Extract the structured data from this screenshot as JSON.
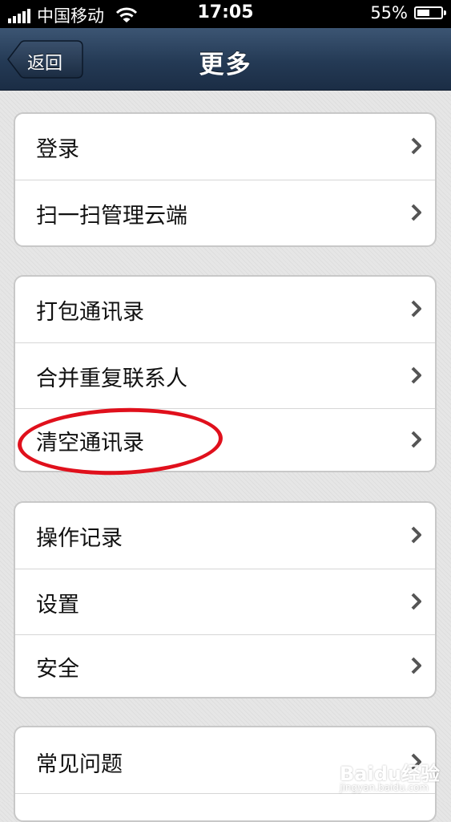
{
  "status_bar": {
    "carrier": "中国移动",
    "time": "17:05",
    "battery": "55%",
    "battery_level": 0.55
  },
  "nav": {
    "back_label": "返回",
    "title": "更多"
  },
  "groups": [
    {
      "items": [
        {
          "label": "登录"
        },
        {
          "label": "扫一扫管理云端"
        }
      ]
    },
    {
      "items": [
        {
          "label": "打包通讯录"
        },
        {
          "label": "合并重复联系人"
        },
        {
          "label": "清空通讯录"
        }
      ]
    },
    {
      "items": [
        {
          "label": "操作记录"
        },
        {
          "label": "设置"
        },
        {
          "label": "安全"
        }
      ]
    },
    {
      "items": [
        {
          "label": "常见问题"
        }
      ]
    }
  ],
  "annotation": {
    "highlighted_item": "清空通讯录",
    "color": "#e0101c"
  },
  "watermark": {
    "text": "Baidu经验",
    "subtext": "jingyan.baidu.com"
  }
}
